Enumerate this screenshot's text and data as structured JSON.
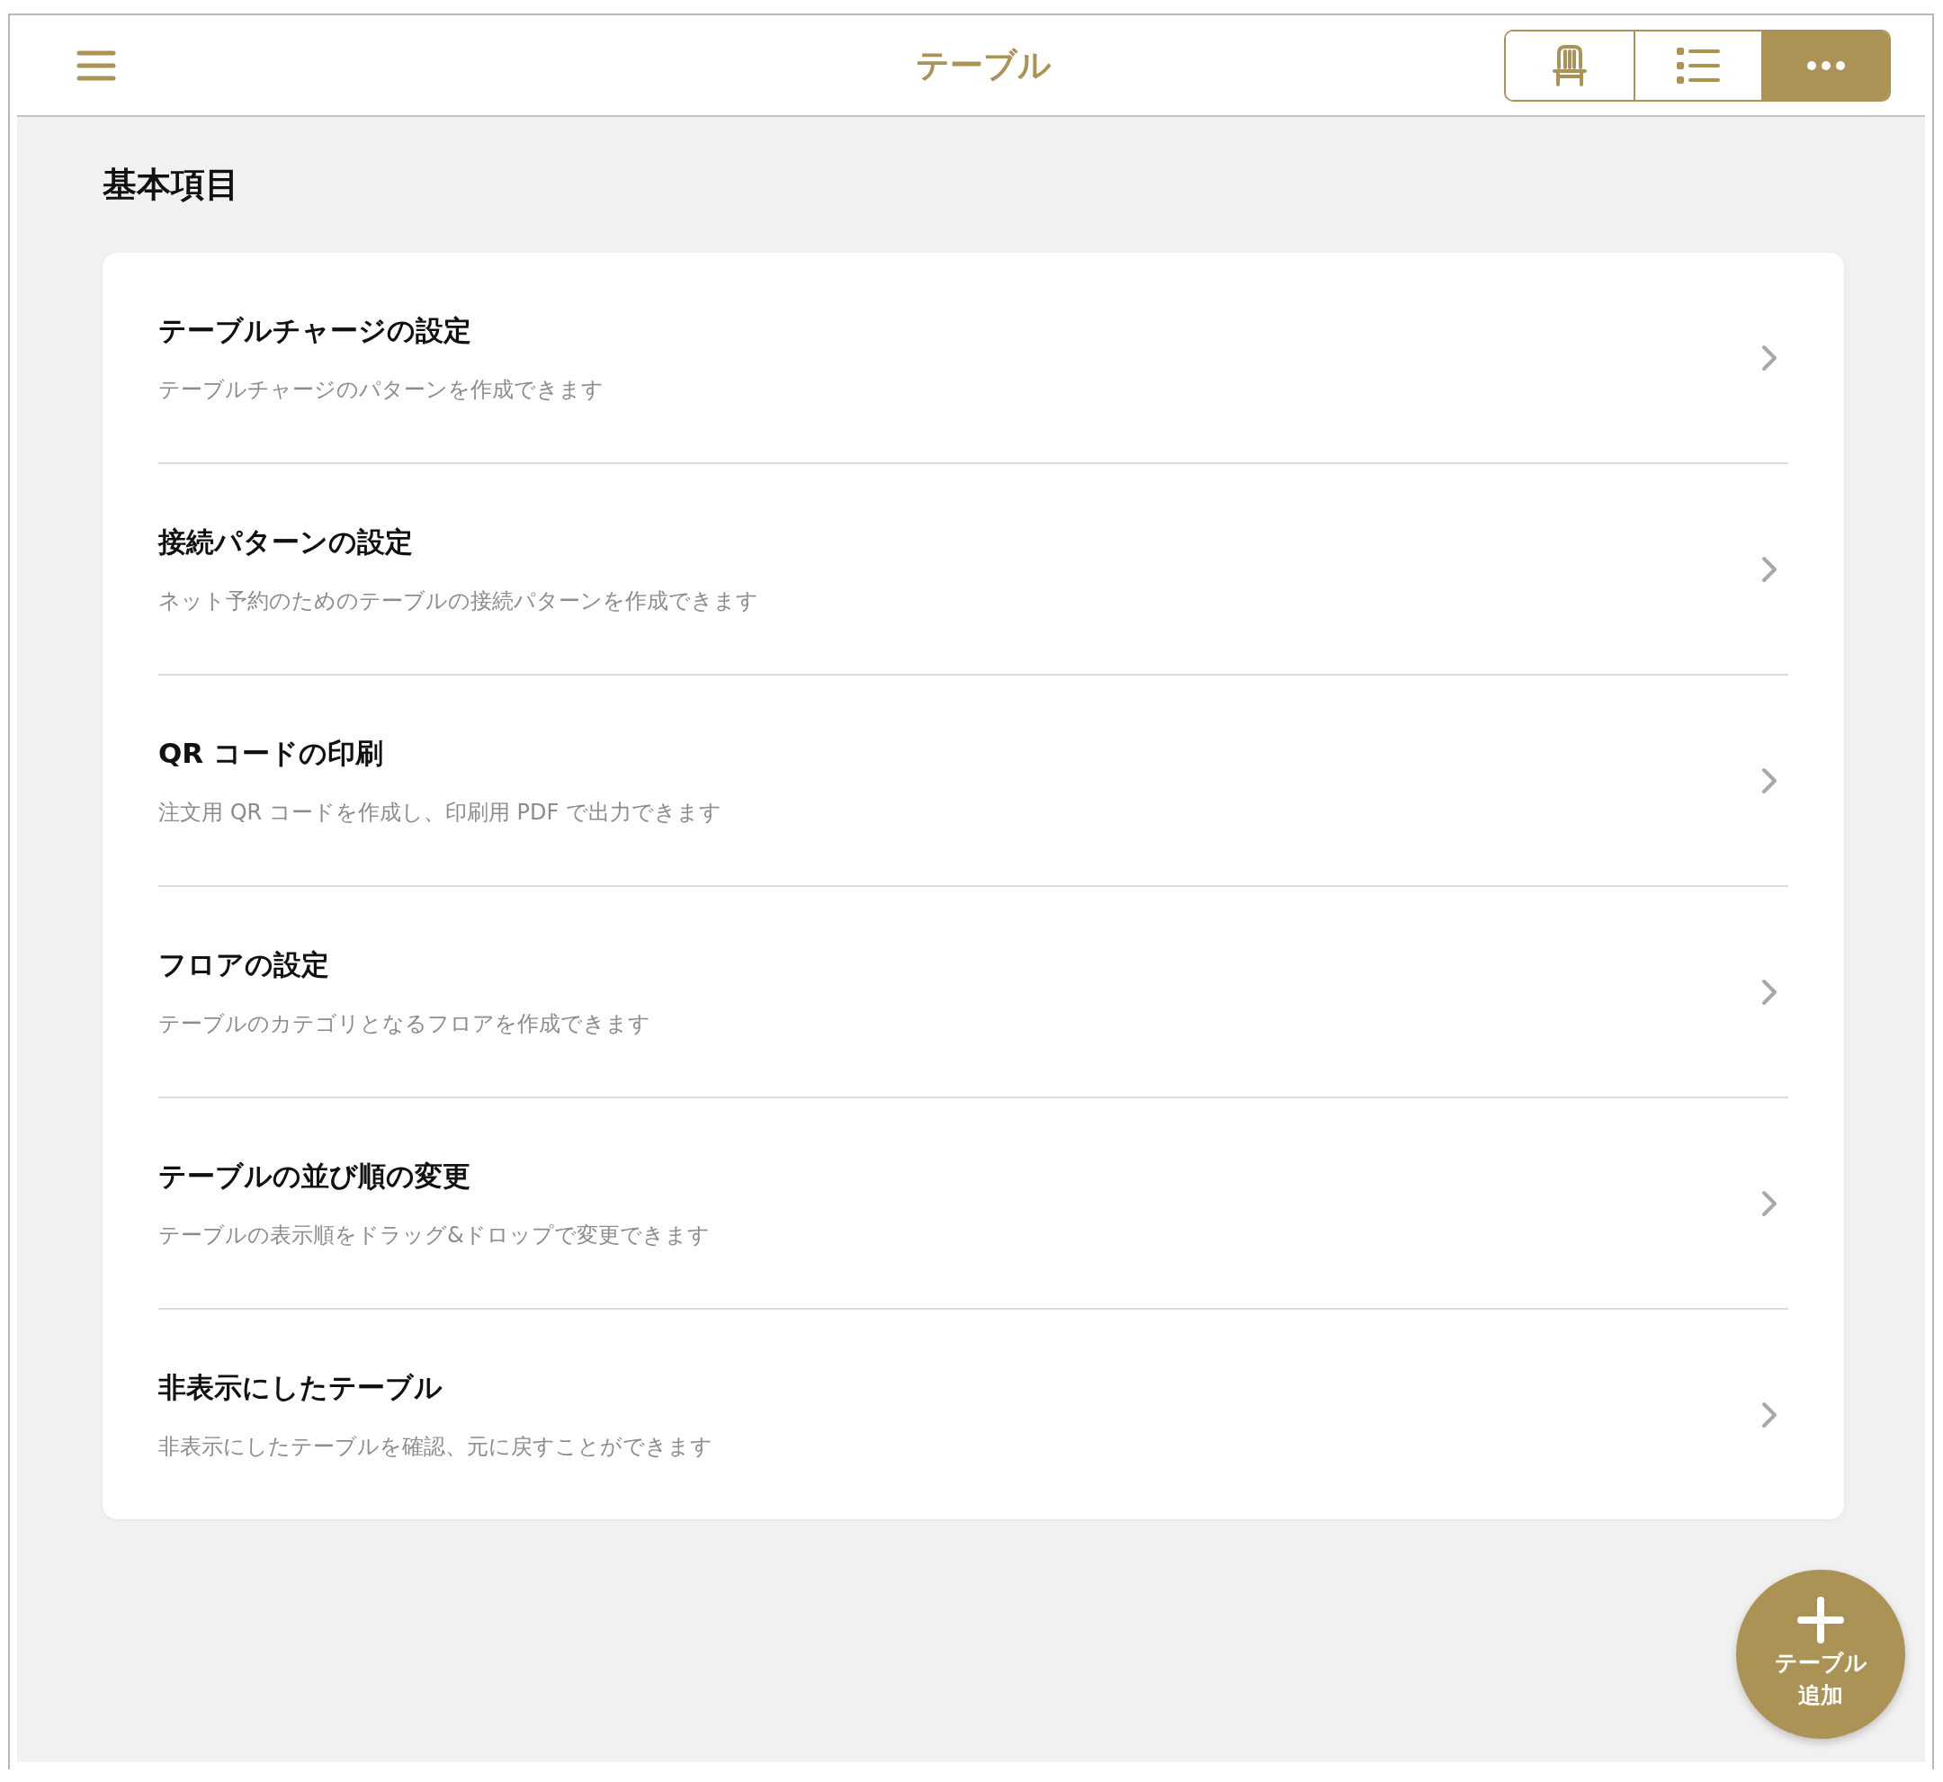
{
  "header": {
    "title": "テーブル",
    "view_switch": [
      {
        "kind": "chair",
        "selected": false
      },
      {
        "kind": "list",
        "selected": false
      },
      {
        "kind": "more",
        "selected": true
      }
    ]
  },
  "section": {
    "title": "基本項目",
    "items": [
      {
        "title": "テーブルチャージの設定",
        "description": "テーブルチャージのパターンを作成できます"
      },
      {
        "title": "接続パターンの設定",
        "description": "ネット予約のためのテーブルの接続パターンを作成できます"
      },
      {
        "title": "QR コードの印刷",
        "description": "注文用 QR コードを作成し、印刷用 PDF で出力できます"
      },
      {
        "title": "フロアの設定",
        "description": "テーブルのカテゴリとなるフロアを作成できます"
      },
      {
        "title": "テーブルの並び順の変更",
        "description": "テーブルの表示順をドラッグ&ドロップで変更できます"
      },
      {
        "title": "非表示にしたテーブル",
        "description": "非表示にしたテーブルを確認、元に戻すことができます"
      }
    ]
  },
  "fab": {
    "label_lines": [
      "テーブル",
      "追加"
    ]
  }
}
